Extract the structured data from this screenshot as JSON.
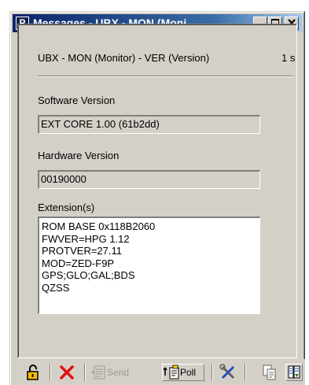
{
  "window": {
    "title": "Messages - UBX - MON (Moni...",
    "app_icon_letter": "P"
  },
  "message": {
    "header": "UBX - MON (Monitor) - VER (Version)",
    "interval": "1 s"
  },
  "software_version": {
    "label": "Software Version",
    "value": "EXT CORE 1.00 (61b2dd)"
  },
  "hardware_version": {
    "label": "Hardware Version",
    "value": "00190000"
  },
  "extensions": {
    "label": "Extension(s)",
    "lines": [
      "ROM BASE 0x118B2060",
      "FWVER=HPG 1.12",
      "PROTVER=27.11",
      "MOD=ZED-F9P",
      "GPS;GLO;GAL;BDS",
      "QZSS"
    ]
  },
  "toolbar": {
    "send_label": "Send",
    "poll_label": "Poll"
  },
  "icons": {
    "lock": "padlock-icon",
    "delete": "red-x-icon",
    "send": "send-icon",
    "poll": "poll-icon",
    "tools": "tools-icon",
    "copy": "copy-icon",
    "dock": "dock-icon"
  },
  "colors": {
    "titlebar_start": "#0a246a",
    "titlebar_end": "#a6caf0",
    "face": "#d4d0c8",
    "delete_red": "#e01010",
    "lock_yellow": "#f0c000"
  }
}
